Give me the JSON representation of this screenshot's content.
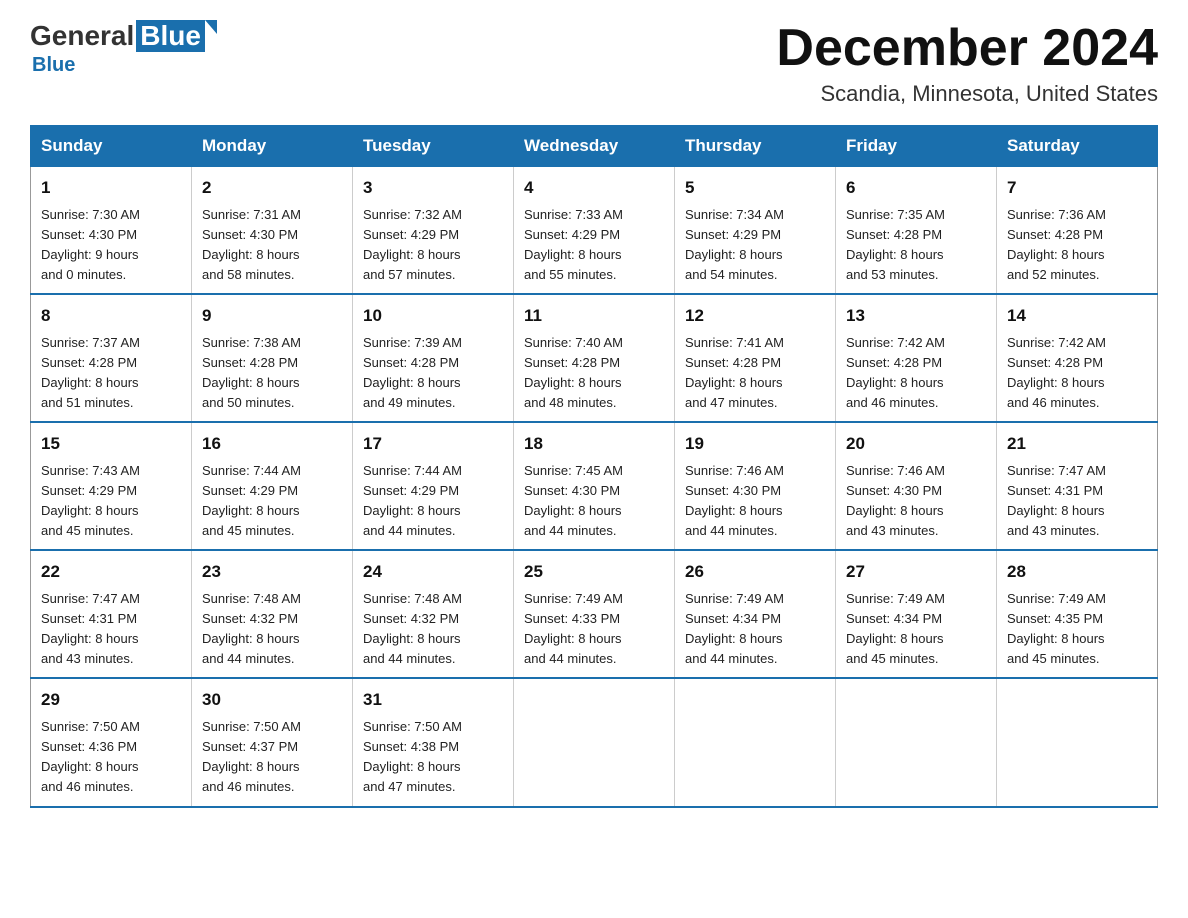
{
  "header": {
    "logo": {
      "general": "General",
      "blue": "Blue",
      "subtitle": "Blue"
    },
    "title": "December 2024",
    "location": "Scandia, Minnesota, United States"
  },
  "days_of_week": [
    "Sunday",
    "Monday",
    "Tuesday",
    "Wednesday",
    "Thursday",
    "Friday",
    "Saturday"
  ],
  "weeks": [
    [
      {
        "day": "1",
        "sunrise": "7:30 AM",
        "sunset": "4:30 PM",
        "daylight": "9 hours and 0 minutes."
      },
      {
        "day": "2",
        "sunrise": "7:31 AM",
        "sunset": "4:30 PM",
        "daylight": "8 hours and 58 minutes."
      },
      {
        "day": "3",
        "sunrise": "7:32 AM",
        "sunset": "4:29 PM",
        "daylight": "8 hours and 57 minutes."
      },
      {
        "day": "4",
        "sunrise": "7:33 AM",
        "sunset": "4:29 PM",
        "daylight": "8 hours and 55 minutes."
      },
      {
        "day": "5",
        "sunrise": "7:34 AM",
        "sunset": "4:29 PM",
        "daylight": "8 hours and 54 minutes."
      },
      {
        "day": "6",
        "sunrise": "7:35 AM",
        "sunset": "4:28 PM",
        "daylight": "8 hours and 53 minutes."
      },
      {
        "day": "7",
        "sunrise": "7:36 AM",
        "sunset": "4:28 PM",
        "daylight": "8 hours and 52 minutes."
      }
    ],
    [
      {
        "day": "8",
        "sunrise": "7:37 AM",
        "sunset": "4:28 PM",
        "daylight": "8 hours and 51 minutes."
      },
      {
        "day": "9",
        "sunrise": "7:38 AM",
        "sunset": "4:28 PM",
        "daylight": "8 hours and 50 minutes."
      },
      {
        "day": "10",
        "sunrise": "7:39 AM",
        "sunset": "4:28 PM",
        "daylight": "8 hours and 49 minutes."
      },
      {
        "day": "11",
        "sunrise": "7:40 AM",
        "sunset": "4:28 PM",
        "daylight": "8 hours and 48 minutes."
      },
      {
        "day": "12",
        "sunrise": "7:41 AM",
        "sunset": "4:28 PM",
        "daylight": "8 hours and 47 minutes."
      },
      {
        "day": "13",
        "sunrise": "7:42 AM",
        "sunset": "4:28 PM",
        "daylight": "8 hours and 46 minutes."
      },
      {
        "day": "14",
        "sunrise": "7:42 AM",
        "sunset": "4:28 PM",
        "daylight": "8 hours and 46 minutes."
      }
    ],
    [
      {
        "day": "15",
        "sunrise": "7:43 AM",
        "sunset": "4:29 PM",
        "daylight": "8 hours and 45 minutes."
      },
      {
        "day": "16",
        "sunrise": "7:44 AM",
        "sunset": "4:29 PM",
        "daylight": "8 hours and 45 minutes."
      },
      {
        "day": "17",
        "sunrise": "7:44 AM",
        "sunset": "4:29 PM",
        "daylight": "8 hours and 44 minutes."
      },
      {
        "day": "18",
        "sunrise": "7:45 AM",
        "sunset": "4:30 PM",
        "daylight": "8 hours and 44 minutes."
      },
      {
        "day": "19",
        "sunrise": "7:46 AM",
        "sunset": "4:30 PM",
        "daylight": "8 hours and 44 minutes."
      },
      {
        "day": "20",
        "sunrise": "7:46 AM",
        "sunset": "4:30 PM",
        "daylight": "8 hours and 43 minutes."
      },
      {
        "day": "21",
        "sunrise": "7:47 AM",
        "sunset": "4:31 PM",
        "daylight": "8 hours and 43 minutes."
      }
    ],
    [
      {
        "day": "22",
        "sunrise": "7:47 AM",
        "sunset": "4:31 PM",
        "daylight": "8 hours and 43 minutes."
      },
      {
        "day": "23",
        "sunrise": "7:48 AM",
        "sunset": "4:32 PM",
        "daylight": "8 hours and 44 minutes."
      },
      {
        "day": "24",
        "sunrise": "7:48 AM",
        "sunset": "4:32 PM",
        "daylight": "8 hours and 44 minutes."
      },
      {
        "day": "25",
        "sunrise": "7:49 AM",
        "sunset": "4:33 PM",
        "daylight": "8 hours and 44 minutes."
      },
      {
        "day": "26",
        "sunrise": "7:49 AM",
        "sunset": "4:34 PM",
        "daylight": "8 hours and 44 minutes."
      },
      {
        "day": "27",
        "sunrise": "7:49 AM",
        "sunset": "4:34 PM",
        "daylight": "8 hours and 45 minutes."
      },
      {
        "day": "28",
        "sunrise": "7:49 AM",
        "sunset": "4:35 PM",
        "daylight": "8 hours and 45 minutes."
      }
    ],
    [
      {
        "day": "29",
        "sunrise": "7:50 AM",
        "sunset": "4:36 PM",
        "daylight": "8 hours and 46 minutes."
      },
      {
        "day": "30",
        "sunrise": "7:50 AM",
        "sunset": "4:37 PM",
        "daylight": "8 hours and 46 minutes."
      },
      {
        "day": "31",
        "sunrise": "7:50 AM",
        "sunset": "4:38 PM",
        "daylight": "8 hours and 47 minutes."
      },
      null,
      null,
      null,
      null
    ]
  ],
  "labels": {
    "sunrise": "Sunrise:",
    "sunset": "Sunset:",
    "daylight": "Daylight:"
  }
}
